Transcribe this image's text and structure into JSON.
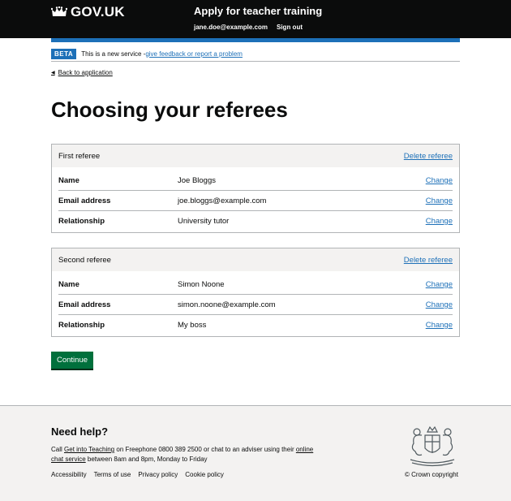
{
  "header": {
    "logo_text": "GOV.UK",
    "service_name": "Apply for teacher training",
    "user_email": "jane.doe@example.com",
    "sign_out": "Sign out"
  },
  "banner": {
    "tag": "BETA",
    "text": "This is a new service - ",
    "link": "give feedback or report a problem"
  },
  "back_link": "Back to application",
  "page_title": "Choosing your referees",
  "referees": [
    {
      "heading": "First referee",
      "delete_label": "Delete referee",
      "rows": [
        {
          "key": "Name",
          "value": "Joe Bloggs",
          "action": "Change"
        },
        {
          "key": "Email address",
          "value": "joe.bloggs@example.com",
          "action": "Change"
        },
        {
          "key": "Relationship",
          "value": "University tutor",
          "action": "Change"
        }
      ]
    },
    {
      "heading": "Second referee",
      "delete_label": "Delete referee",
      "rows": [
        {
          "key": "Name",
          "value": "Simon Noone",
          "action": "Change"
        },
        {
          "key": "Email address",
          "value": "simon.noone@example.com",
          "action": "Change"
        },
        {
          "key": "Relationship",
          "value": "My boss",
          "action": "Change"
        }
      ]
    }
  ],
  "continue_button": "Continue",
  "footer": {
    "help_title": "Need help?",
    "help_pre": "Call ",
    "help_link1": "Get into Teaching",
    "help_mid": " on Freephone 0800 389 2500 or chat to an adviser using their ",
    "help_link2": "online chat service",
    "help_post": " between 8am and 8pm, Monday to Friday",
    "links": [
      "Accessibility",
      "Terms of use",
      "Privacy policy",
      "Cookie policy"
    ],
    "copyright": "© Crown copyright"
  }
}
